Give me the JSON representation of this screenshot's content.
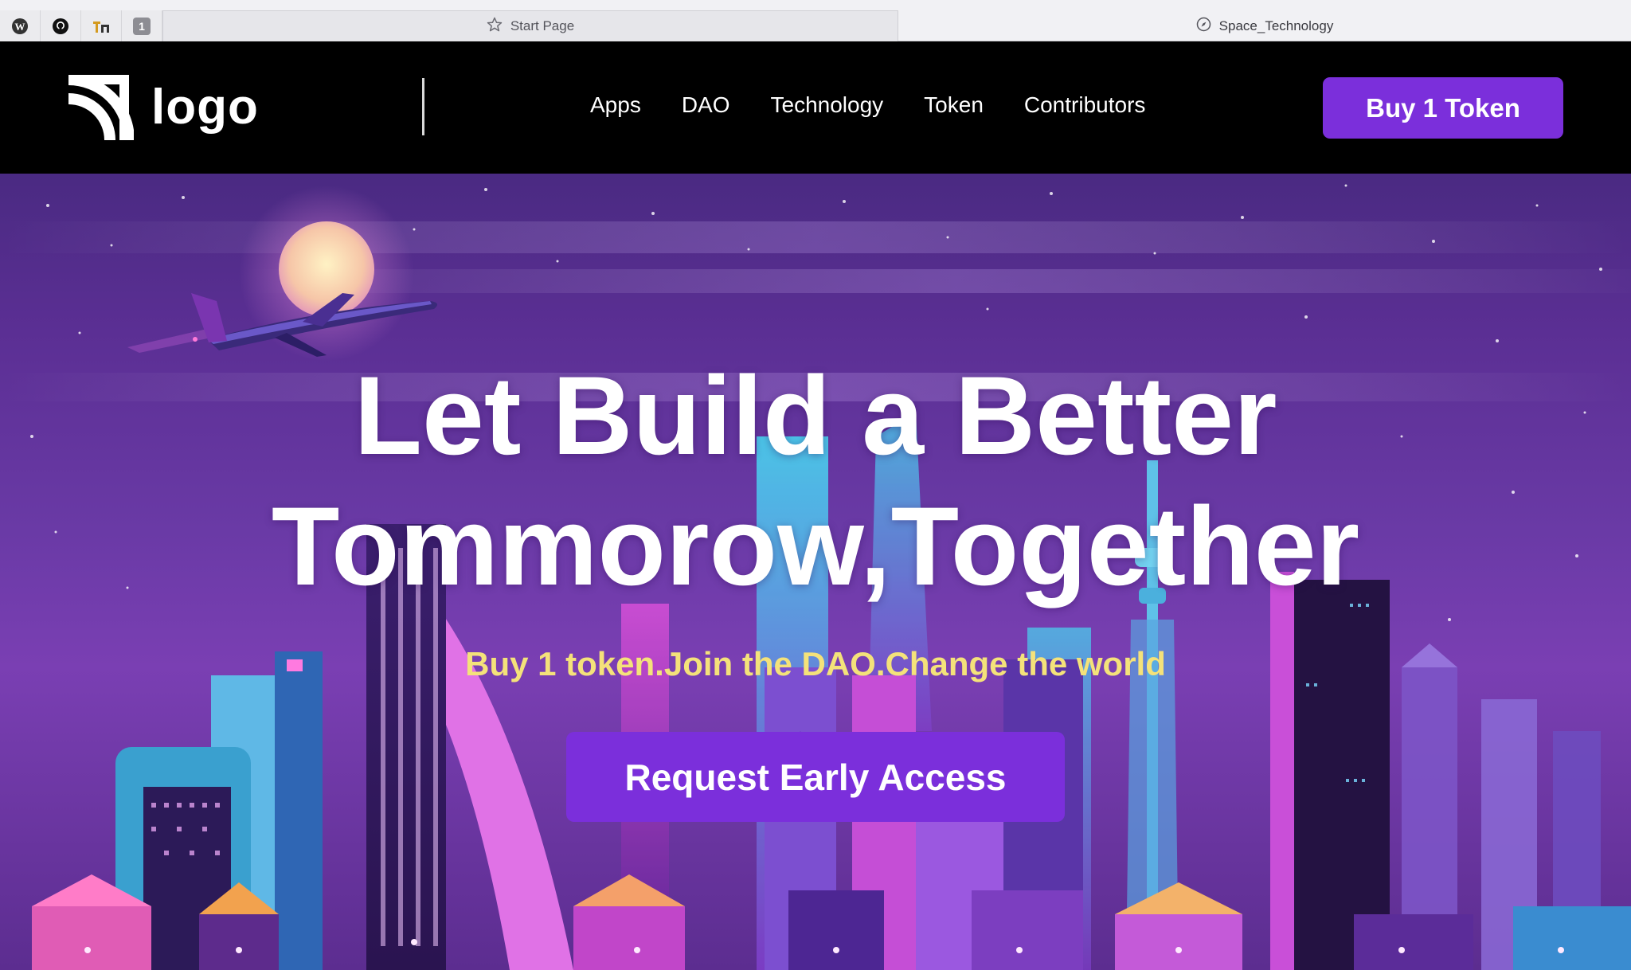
{
  "browser": {
    "pinned_tabs": [
      {
        "icon": "wordpress-icon"
      },
      {
        "icon": "github-icon"
      },
      {
        "icon": "tm-icon"
      },
      {
        "icon": "number-badge-icon",
        "label": "1"
      }
    ],
    "active_tab": {
      "title": "Start Page",
      "icon": "star-icon"
    },
    "other_tab": {
      "title": "Space_Technology",
      "icon": "compass-icon"
    }
  },
  "navbar": {
    "logo_text": "logo",
    "logo_icon": "rss-arcs-icon",
    "links": [
      "Apps",
      "DAO",
      "Technology",
      "Token",
      "Contributors"
    ],
    "buy_button": "Buy 1 Token"
  },
  "hero": {
    "headline_line1": "Let Build a Better",
    "headline_line2": "Tommorow,Together",
    "tagline": "Buy 1 token.Join the DAO.Change the world",
    "cta": "Request Early Access",
    "background": "neon-city-skyline-illustration"
  },
  "colors": {
    "accent": "#7b2fdb",
    "tagline": "#f4e27a",
    "navbar_bg": "#000000"
  }
}
